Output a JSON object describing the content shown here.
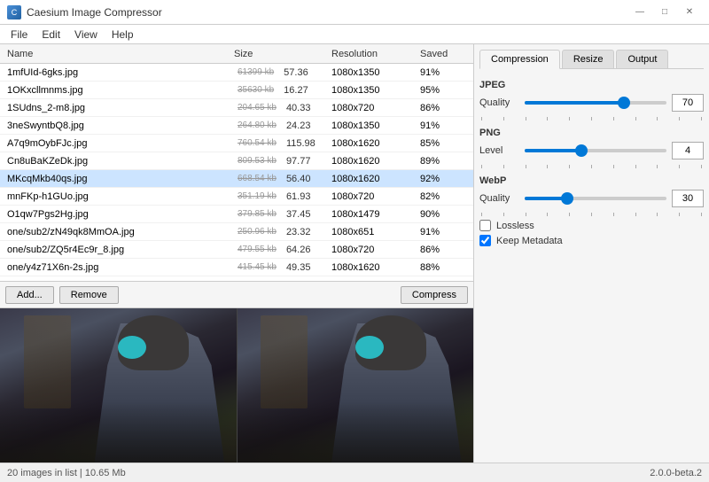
{
  "window": {
    "title": "Caesium Image Compressor",
    "controls": {
      "minimize": "—",
      "maximize": "□",
      "close": "✕"
    }
  },
  "menu": {
    "items": [
      "File",
      "Edit",
      "View",
      "Help"
    ]
  },
  "file_table": {
    "headers": [
      "Name",
      "Size",
      "Resolution",
      "Saved"
    ],
    "rows": [
      {
        "name": "1mfUId-6gks.jpg",
        "size_old": "61399 kb",
        "size_new": "57.36",
        "resolution": "1080x1350",
        "saved": "91%"
      },
      {
        "name": "1OKxcllmnms.jpg",
        "size_old": "35630 kb",
        "size_new": "16.27",
        "resolution": "1080x1350",
        "saved": "95%"
      },
      {
        "name": "1SUdns_2-m8.jpg",
        "size_old": "204.65 kb",
        "size_new": "40.33",
        "resolution": "1080x720",
        "saved": "86%"
      },
      {
        "name": "3neSwyntbQ8.jpg",
        "size_old": "264.80 kb",
        "size_new": "24.23",
        "resolution": "1080x1350",
        "saved": "91%"
      },
      {
        "name": "A7q9mOybFJc.jpg",
        "size_old": "760.54 kb",
        "size_new": "115.98",
        "resolution": "1080x1620",
        "saved": "85%"
      },
      {
        "name": "Cn8uBaKZeDk.jpg",
        "size_old": "809.53 kb",
        "size_new": "97.77",
        "resolution": "1080x1620",
        "saved": "89%"
      },
      {
        "name": "MKcqMkb40qs.jpg",
        "size_old": "668.54 kb",
        "size_new": "56.40",
        "resolution": "1080x1620",
        "saved": "92%",
        "selected": true
      },
      {
        "name": "mnFKp-h1GUo.jpg",
        "size_old": "351.19 kb",
        "size_new": "61.93",
        "resolution": "1080x720",
        "saved": "82%"
      },
      {
        "name": "O1qw7Pgs2Hg.jpg",
        "size_old": "379.85 kb",
        "size_new": "37.45",
        "resolution": "1080x1479",
        "saved": "90%"
      },
      {
        "name": "one/sub2/zN49qk8MmOA.jpg",
        "size_old": "250.96 kb",
        "size_new": "23.32",
        "resolution": "1080x651",
        "saved": "91%"
      },
      {
        "name": "one/sub2/ZQ5r4Ec9r_8.jpg",
        "size_old": "479.55 kb",
        "size_new": "64.26",
        "resolution": "1080x720",
        "saved": "86%"
      },
      {
        "name": "one/y4z71X6n-2s.jpg",
        "size_old": "415.45 kb",
        "size_new": "49.35",
        "resolution": "1080x1620",
        "saved": "88%"
      }
    ]
  },
  "buttons": {
    "add": "Add...",
    "remove": "Remove",
    "compress": "Compress"
  },
  "right_panel": {
    "tabs": [
      "Compression",
      "Resize",
      "Output"
    ],
    "active_tab": "Compression",
    "jpeg": {
      "label": "JPEG",
      "quality_label": "Quality",
      "quality_value": "70",
      "slider_percent": 70
    },
    "png": {
      "label": "PNG",
      "level_label": "Level",
      "level_value": "4",
      "slider_percent": 40
    },
    "webp": {
      "label": "WebP",
      "quality_label": "Quality",
      "quality_value": "30",
      "slider_percent": 30
    },
    "checkboxes": {
      "lossless": {
        "label": "Lossless",
        "checked": false
      },
      "keep_metadata": {
        "label": "Keep Metadata",
        "checked": true
      }
    }
  },
  "status_bar": {
    "info": "20 images in list | 10.65 Mb",
    "version": "2.0.0-beta.2"
  }
}
